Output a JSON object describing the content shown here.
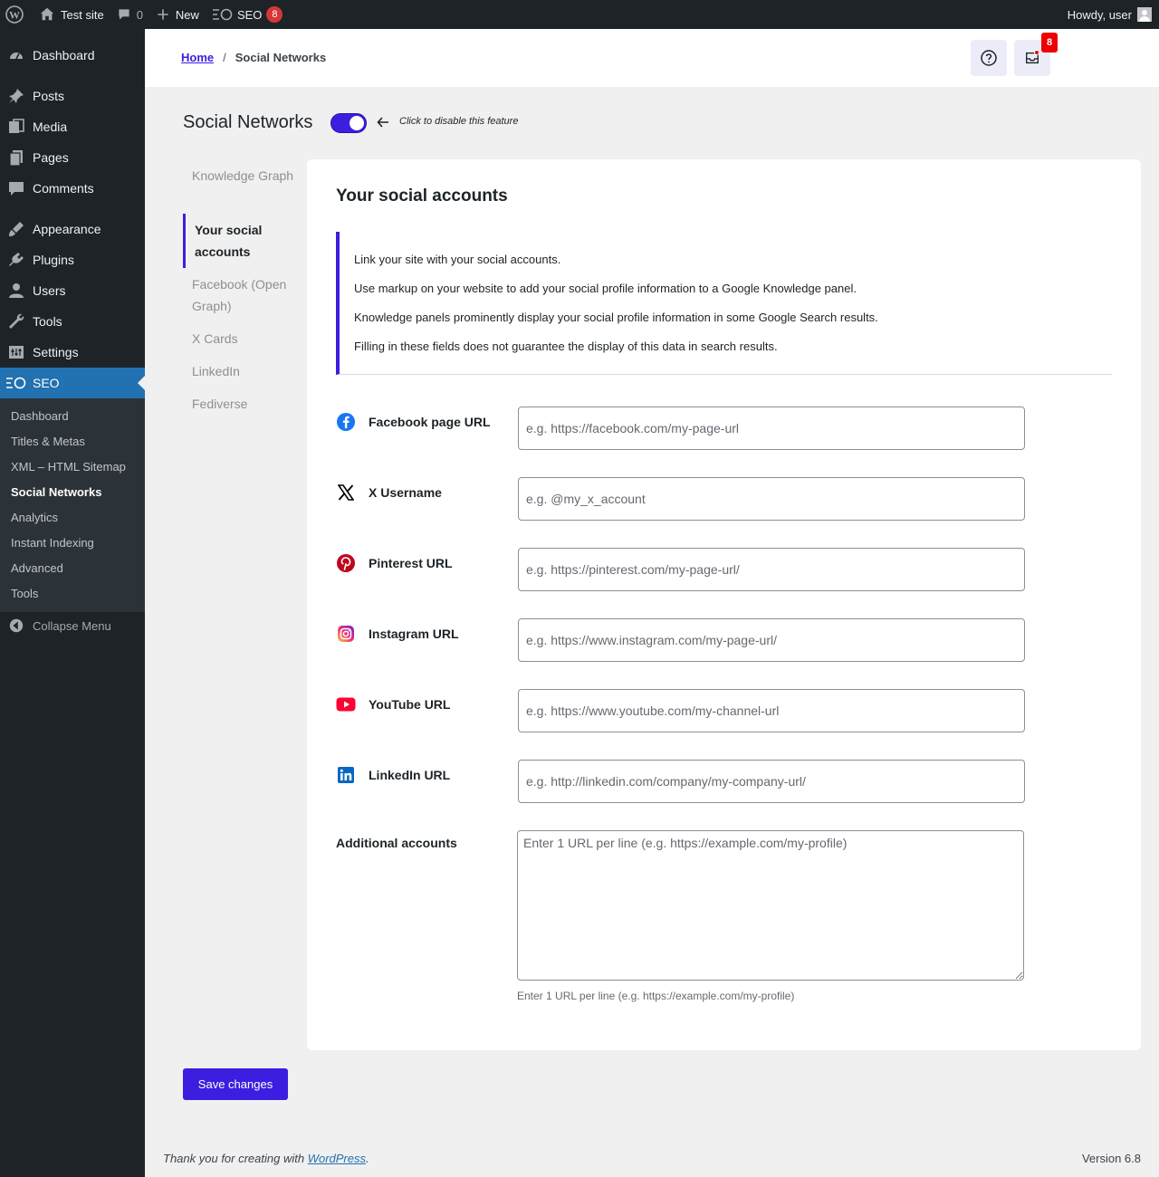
{
  "adminbar": {
    "site_name": "Test site",
    "comments_count": "0",
    "new_label": "New",
    "seo_label": "SEO",
    "seo_badge": "8",
    "howdy": "Howdy, user"
  },
  "sidebar": {
    "items": [
      {
        "label": "Dashboard",
        "icon": "dashboard-icon"
      },
      {
        "label": "Posts",
        "icon": "pin-icon"
      },
      {
        "label": "Media",
        "icon": "media-icon"
      },
      {
        "label": "Pages",
        "icon": "pages-icon"
      },
      {
        "label": "Comments",
        "icon": "comment-icon"
      },
      {
        "label": "Appearance",
        "icon": "brush-icon"
      },
      {
        "label": "Plugins",
        "icon": "plugin-icon"
      },
      {
        "label": "Users",
        "icon": "user-icon"
      },
      {
        "label": "Tools",
        "icon": "wrench-icon"
      },
      {
        "label": "Settings",
        "icon": "settings-icon"
      },
      {
        "label": "SEO",
        "icon": "seo-icon"
      }
    ],
    "submenu": [
      {
        "label": "Dashboard"
      },
      {
        "label": "Titles & Metas"
      },
      {
        "label": "XML – HTML Sitemap"
      },
      {
        "label": "Social Networks"
      },
      {
        "label": "Analytics"
      },
      {
        "label": "Instant Indexing"
      },
      {
        "label": "Advanced"
      },
      {
        "label": "Tools"
      }
    ],
    "collapse": "Collapse Menu"
  },
  "topbar": {
    "breadcrumb_home": "Home",
    "breadcrumb_sep": "/",
    "breadcrumb_current": "Social Networks",
    "notif_count": "8"
  },
  "page": {
    "title": "Social Networks",
    "toggle_hint": "Click to disable this feature",
    "toggle_on": true
  },
  "subnav": [
    {
      "label": "Knowledge Graph"
    },
    {
      "label": "Your social accounts"
    },
    {
      "label": "Facebook (Open Graph)"
    },
    {
      "label": "X Cards"
    },
    {
      "label": "LinkedIn"
    },
    {
      "label": "Fediverse"
    }
  ],
  "card": {
    "title": "Your social accounts",
    "notice": [
      "Link your site with your social accounts.",
      "Use markup on your website to add your social profile information to a Google Knowledge panel.",
      "Knowledge panels prominently display your social profile information in some Google Search results.",
      "Filling in these fields does not guarantee the display of this data in search results."
    ],
    "fields": [
      {
        "label": "Facebook page URL",
        "placeholder": "e.g. https://facebook.com/my-page-url",
        "value": "",
        "icon": "facebook-icon",
        "color": "#1877f2"
      },
      {
        "label": "X Username",
        "placeholder": "e.g. @my_x_account",
        "value": "",
        "icon": "x-icon",
        "color": "#000000"
      },
      {
        "label": "Pinterest URL",
        "placeholder": "e.g. https://pinterest.com/my-page-url/",
        "value": "",
        "icon": "pinterest-icon",
        "color": "#bd081c"
      },
      {
        "label": "Instagram URL",
        "placeholder": "e.g. https://www.instagram.com/my-page-url/",
        "value": "",
        "icon": "instagram-icon",
        "color": "#e1306c"
      },
      {
        "label": "YouTube URL",
        "placeholder": "e.g. https://www.youtube.com/my-channel-url",
        "value": "",
        "icon": "youtube-icon",
        "color": "#ff0033"
      },
      {
        "label": "LinkedIn URL",
        "placeholder": "e.g. http://linkedin.com/company/my-company-url/",
        "value": "",
        "icon": "linkedin-icon",
        "color": "#0a66c2"
      }
    ],
    "additional": {
      "label": "Additional accounts",
      "placeholder": "Enter 1 URL per line (e.g. https://example.com/my-profile)",
      "help": "Enter 1 URL per line (e.g. https://example.com/my-profile)"
    }
  },
  "save_label": "Save changes",
  "footer": {
    "thanks_prefix": "Thank you for creating with ",
    "wordpress_link": "WordPress",
    "thanks_suffix": ".",
    "version": "Version 6.8"
  },
  "colors": {
    "accent": "#3c1ee0",
    "admin_bg": "#1d2327",
    "current_menu": "#2271b1"
  }
}
